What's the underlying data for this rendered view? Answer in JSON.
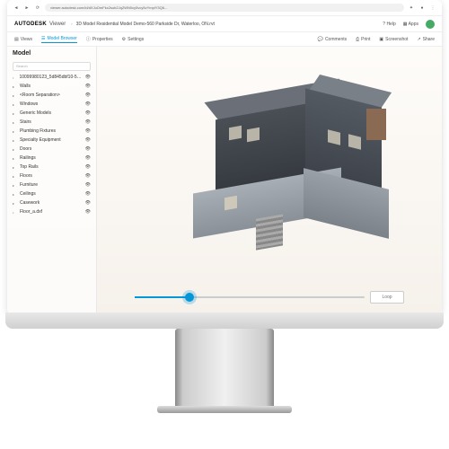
{
  "chrome": {
    "url": "viewer.autodesk.com/id/dXJuOmFkc2sub2JqZWN0cy5vcy5vYmplY3Q6..."
  },
  "header": {
    "brand": "AUTODESK",
    "product": "Viewer",
    "filename": "3D Model Residential Model Demo-560 Parkside Dr, Waterloo, ON.rvt",
    "help": "Help",
    "apps": "Apps"
  },
  "tabs": {
    "views": "Views",
    "model_browser": "Model Browser",
    "properties": "Properties",
    "settings": "Settings",
    "comments": "Comments",
    "print": "Print",
    "screenshot": "Screenshot",
    "share": "Share"
  },
  "sidebar": {
    "title": "Model",
    "search_placeholder": "Search",
    "items": [
      {
        "label": "10099980123_5d845dbf10-560-w...",
        "leaf": true
      },
      {
        "label": "Walls",
        "leaf": false
      },
      {
        "label": "<Room Separation>",
        "leaf": false
      },
      {
        "label": "Windows",
        "leaf": false
      },
      {
        "label": "Generic Models",
        "leaf": false
      },
      {
        "label": "Stairs",
        "leaf": false
      },
      {
        "label": "Plumbing Fixtures",
        "leaf": false
      },
      {
        "label": "Specialty Equipment",
        "leaf": false
      },
      {
        "label": "Doors",
        "leaf": false
      },
      {
        "label": "Railings",
        "leaf": false
      },
      {
        "label": "Top Rails",
        "leaf": false
      },
      {
        "label": "Floors",
        "leaf": false
      },
      {
        "label": "Furniture",
        "leaf": false
      },
      {
        "label": "Ceilings",
        "leaf": false
      },
      {
        "label": "Casework",
        "leaf": false
      },
      {
        "label": "Floor_a.dxf",
        "leaf": true
      }
    ]
  },
  "slider": {
    "loop": "Loop"
  }
}
